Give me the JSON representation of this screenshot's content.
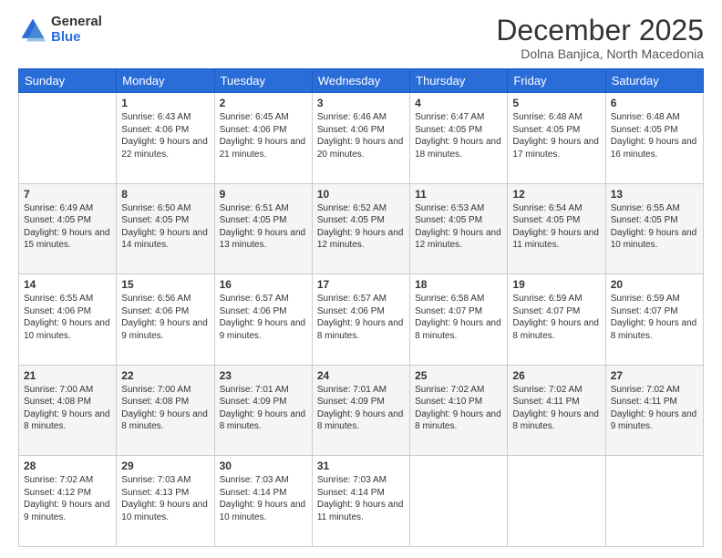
{
  "logo": {
    "general": "General",
    "blue": "Blue"
  },
  "header": {
    "title": "December 2025",
    "subtitle": "Dolna Banjica, North Macedonia"
  },
  "days_of_week": [
    "Sunday",
    "Monday",
    "Tuesday",
    "Wednesday",
    "Thursday",
    "Friday",
    "Saturday"
  ],
  "weeks": [
    [
      {
        "day": "",
        "info": ""
      },
      {
        "day": "1",
        "info": "Sunrise: 6:43 AM\nSunset: 4:06 PM\nDaylight: 9 hours and 22 minutes."
      },
      {
        "day": "2",
        "info": "Sunrise: 6:45 AM\nSunset: 4:06 PM\nDaylight: 9 hours and 21 minutes."
      },
      {
        "day": "3",
        "info": "Sunrise: 6:46 AM\nSunset: 4:06 PM\nDaylight: 9 hours and 20 minutes."
      },
      {
        "day": "4",
        "info": "Sunrise: 6:47 AM\nSunset: 4:05 PM\nDaylight: 9 hours and 18 minutes."
      },
      {
        "day": "5",
        "info": "Sunrise: 6:48 AM\nSunset: 4:05 PM\nDaylight: 9 hours and 17 minutes."
      },
      {
        "day": "6",
        "info": "Sunrise: 6:48 AM\nSunset: 4:05 PM\nDaylight: 9 hours and 16 minutes."
      }
    ],
    [
      {
        "day": "7",
        "info": "Sunrise: 6:49 AM\nSunset: 4:05 PM\nDaylight: 9 hours and 15 minutes."
      },
      {
        "day": "8",
        "info": "Sunrise: 6:50 AM\nSunset: 4:05 PM\nDaylight: 9 hours and 14 minutes."
      },
      {
        "day": "9",
        "info": "Sunrise: 6:51 AM\nSunset: 4:05 PM\nDaylight: 9 hours and 13 minutes."
      },
      {
        "day": "10",
        "info": "Sunrise: 6:52 AM\nSunset: 4:05 PM\nDaylight: 9 hours and 12 minutes."
      },
      {
        "day": "11",
        "info": "Sunrise: 6:53 AM\nSunset: 4:05 PM\nDaylight: 9 hours and 12 minutes."
      },
      {
        "day": "12",
        "info": "Sunrise: 6:54 AM\nSunset: 4:05 PM\nDaylight: 9 hours and 11 minutes."
      },
      {
        "day": "13",
        "info": "Sunrise: 6:55 AM\nSunset: 4:05 PM\nDaylight: 9 hours and 10 minutes."
      }
    ],
    [
      {
        "day": "14",
        "info": "Sunrise: 6:55 AM\nSunset: 4:06 PM\nDaylight: 9 hours and 10 minutes."
      },
      {
        "day": "15",
        "info": "Sunrise: 6:56 AM\nSunset: 4:06 PM\nDaylight: 9 hours and 9 minutes."
      },
      {
        "day": "16",
        "info": "Sunrise: 6:57 AM\nSunset: 4:06 PM\nDaylight: 9 hours and 9 minutes."
      },
      {
        "day": "17",
        "info": "Sunrise: 6:57 AM\nSunset: 4:06 PM\nDaylight: 9 hours and 8 minutes."
      },
      {
        "day": "18",
        "info": "Sunrise: 6:58 AM\nSunset: 4:07 PM\nDaylight: 9 hours and 8 minutes."
      },
      {
        "day": "19",
        "info": "Sunrise: 6:59 AM\nSunset: 4:07 PM\nDaylight: 9 hours and 8 minutes."
      },
      {
        "day": "20",
        "info": "Sunrise: 6:59 AM\nSunset: 4:07 PM\nDaylight: 9 hours and 8 minutes."
      }
    ],
    [
      {
        "day": "21",
        "info": "Sunrise: 7:00 AM\nSunset: 4:08 PM\nDaylight: 9 hours and 8 minutes."
      },
      {
        "day": "22",
        "info": "Sunrise: 7:00 AM\nSunset: 4:08 PM\nDaylight: 9 hours and 8 minutes."
      },
      {
        "day": "23",
        "info": "Sunrise: 7:01 AM\nSunset: 4:09 PM\nDaylight: 9 hours and 8 minutes."
      },
      {
        "day": "24",
        "info": "Sunrise: 7:01 AM\nSunset: 4:09 PM\nDaylight: 9 hours and 8 minutes."
      },
      {
        "day": "25",
        "info": "Sunrise: 7:02 AM\nSunset: 4:10 PM\nDaylight: 9 hours and 8 minutes."
      },
      {
        "day": "26",
        "info": "Sunrise: 7:02 AM\nSunset: 4:11 PM\nDaylight: 9 hours and 8 minutes."
      },
      {
        "day": "27",
        "info": "Sunrise: 7:02 AM\nSunset: 4:11 PM\nDaylight: 9 hours and 9 minutes."
      }
    ],
    [
      {
        "day": "28",
        "info": "Sunrise: 7:02 AM\nSunset: 4:12 PM\nDaylight: 9 hours and 9 minutes."
      },
      {
        "day": "29",
        "info": "Sunrise: 7:03 AM\nSunset: 4:13 PM\nDaylight: 9 hours and 10 minutes."
      },
      {
        "day": "30",
        "info": "Sunrise: 7:03 AM\nSunset: 4:14 PM\nDaylight: 9 hours and 10 minutes."
      },
      {
        "day": "31",
        "info": "Sunrise: 7:03 AM\nSunset: 4:14 PM\nDaylight: 9 hours and 11 minutes."
      },
      {
        "day": "",
        "info": ""
      },
      {
        "day": "",
        "info": ""
      },
      {
        "day": "",
        "info": ""
      }
    ]
  ]
}
